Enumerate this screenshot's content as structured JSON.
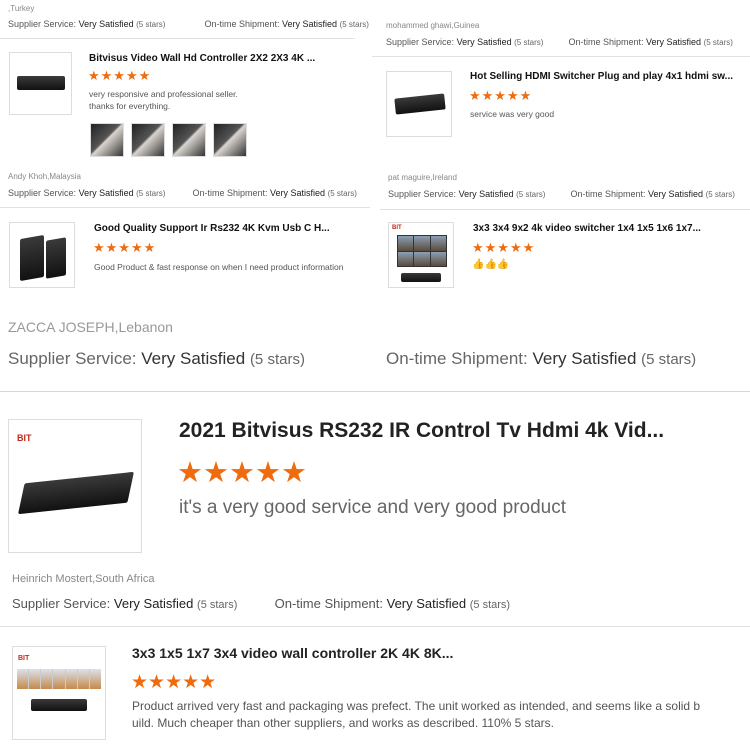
{
  "labels": {
    "supplier_service": "Supplier Service:",
    "ontime_shipment": "On-time Shipment:"
  },
  "reviews": [
    {
      "location": ",Turkey",
      "supplier_rating": "Very Satisfied",
      "supplier_stars": "(5 stars)",
      "shipment_rating": "Very Satisfied",
      "shipment_stars": "(5 stars)"
    },
    {
      "location": "mohammed ghawi,Guinea",
      "supplier_rating": "Very Satisfied",
      "supplier_stars": "(5 stars)",
      "shipment_rating": "Very Satisfied",
      "shipment_stars": "(5 stars)",
      "title": "Hot Selling HDMI Switcher Plug and play 4x1 hdmi sw...",
      "stars": "★★★★★",
      "text": "service was very good"
    },
    {
      "title": "Bitvisus Video Wall Hd Controller 2X2 2X3 4K ...",
      "stars": "★★★★★",
      "text_lines": [
        "very responsive and professional seller.",
        "thanks for everything."
      ],
      "location": "Andy Khoh,Malaysia",
      "supplier_rating": "Very Satisfied",
      "supplier_stars": "(5 stars)",
      "shipment_rating": "Very Satisfied",
      "shipment_stars": "(5 stars)"
    },
    {
      "location": "pat maguire,Ireland",
      "supplier_rating": "Very Satisfied",
      "supplier_stars": "(5 stars)",
      "shipment_rating": "Very Satisfied",
      "shipment_stars": "(5 stars)",
      "title": "3x3 3x4 9x2 4k video switcher 1x4 1x5 1x6 1x7...",
      "stars": "★★★★★",
      "text": "👍👍👍"
    },
    {
      "title": "Good Quality Support Ir Rs232 4K Kvm Usb C H...",
      "stars": "★★★★★",
      "text": "Good Product & fast response on when I need product information"
    },
    {
      "location": "ZACCA JOSEPH,Lebanon",
      "supplier_rating": "Very Satisfied",
      "supplier_stars": "(5 stars)",
      "shipment_rating": "Very Satisfied",
      "shipment_stars": "(5 stars)",
      "logo": "BIT",
      "title": "2021 Bitvisus RS232 IR Control Tv Hdmi 4k Vid...",
      "stars": "★★★★★",
      "text": "it's a very good service and very good product"
    },
    {
      "location": "Heinrich Mostert,South Africa",
      "supplier_rating": "Very Satisfied",
      "supplier_stars": "(5 stars)",
      "shipment_rating": "Very Satisfied",
      "shipment_stars": "(5 stars)",
      "logo": "BIT",
      "title": "3x3 1x5 1x7 3x4 video wall controller 2K 4K 8K...",
      "stars": "★★★★★",
      "text_lines": [
        "Product arrived very fast and packaging was prefect.  The unit worked as intended, and seems like a solid b",
        "uild.  Much cheaper than other suppliers, and works as described.  110% 5 stars."
      ]
    }
  ],
  "colors": {
    "star": "#f06a0e",
    "divider": "#e2e2e2",
    "brand_logo": "#c0281d"
  },
  "icons": {
    "rating": "star-icon",
    "thumbs": "thumbs-up-icon"
  }
}
